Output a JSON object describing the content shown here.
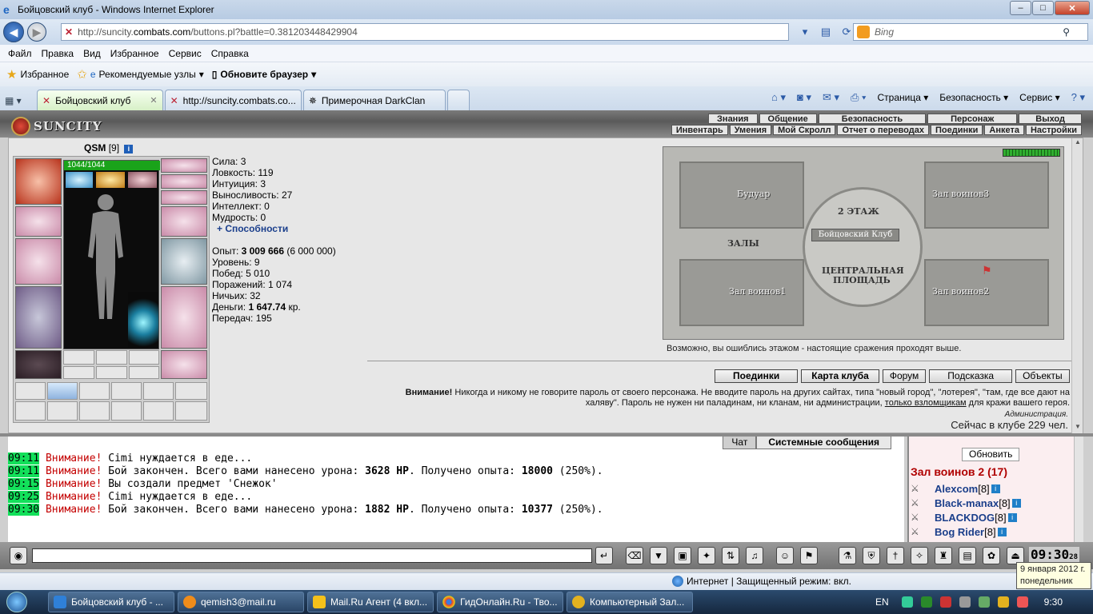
{
  "window": {
    "title": "Бойцовский клуб - Windows Internet Explorer"
  },
  "address": {
    "url_prefix": "http://suncity.",
    "url_domain": "combats.com",
    "url_rest": "/buttons.pl?battle=0.381203448429904",
    "search_placeholder": "Bing"
  },
  "menu": [
    "Файл",
    "Правка",
    "Вид",
    "Избранное",
    "Сервис",
    "Справка"
  ],
  "favbar": {
    "favorites": "Избранное",
    "suggested": "Рекомендуемые узлы",
    "update": "Обновите браузер"
  },
  "tabs": [
    {
      "label": "Бойцовский клуб"
    },
    {
      "label": "http://suncity.combats.co..."
    },
    {
      "label": "Примерочная DarkClan"
    }
  ],
  "cmdbar": {
    "page": "Страница",
    "safety": "Безопасность",
    "tools": "Сервис"
  },
  "game": {
    "logo": "SUNCITY",
    "top_menu": [
      "Знания",
      "Общение",
      "Безопасность",
      "Персонаж",
      "Выход"
    ],
    "sub_menu": [
      "Инвентарь",
      "Умения",
      "Мой Скролл",
      "Отчет о переводах",
      "Поединки",
      "Анкета",
      "Настройки"
    ],
    "character": {
      "name": "QSM",
      "level": "[9]",
      "info": "i",
      "hp": "1044/1044"
    },
    "stats": {
      "strength": "Сила: 3",
      "agility": "Ловкость: 119",
      "intuition": "Интуиция: 3",
      "endurance": "Выносливость: 27",
      "intellect": "Интеллект: 0",
      "wisdom": "Мудрость: 0",
      "abilities": "+ Способности",
      "exp_label": "Опыт: ",
      "exp_value": "3 009 666",
      "exp_next": " (6 000 000)",
      "level": "Уровень: 9",
      "wins": "Побед: 5 010",
      "losses": "Поражений: 1 074",
      "draws": "Ничьих: 32",
      "money_label": "Деньги: ",
      "money_value": "1 647.74",
      "money_unit": " кр.",
      "transfers": "Передач: 195"
    },
    "map": {
      "rooms": {
        "boudoir": "Будуар",
        "hall3": "Зал воинов3",
        "floor2": "2 ЭТАЖ",
        "club": "Бойцовский Клуб",
        "halls": "ЗАЛЫ",
        "central1": "ЦЕНТРАЛЬНАЯ",
        "central2": "ПЛОЩАДЬ",
        "hall1": "Зал воинов1",
        "hall2": "Зал воинов2"
      },
      "caption": "Возможно, вы ошиблись этажом - настоящие сражения проходят выше."
    },
    "nav_buttons": [
      "Поединки",
      "Карта клуба",
      "Форум",
      "Подсказка",
      "Объекты"
    ],
    "warning": {
      "head": "Внимание!",
      "text1": " Никогда и никому не говорите пароль от своего персонажа. Не вводите пароль на других сайтах, типа \"новый город\", \"лотерея\", \"там, где все дают на халяву\". Пароль не нужен ни паладинам, ни кланам, ни администрации, ",
      "link": "только взломщикам",
      "text2": " для кражи вашего героя.",
      "signature": "Администрация."
    },
    "online": "Сейчас в клубе 229 чел."
  },
  "chat": {
    "tabs": [
      "Чат",
      "Системные сообщения"
    ],
    "lines": [
      {
        "time": "09:11",
        "head": "Внимание!",
        "text": " Cimi нуждается в еде..."
      },
      {
        "time": "09:11",
        "head": "Внимание!",
        "text": " Бой закончен. Всего вами нанесено урона: ",
        "b1": "3628 HP",
        "text2": ". Получено опыта: ",
        "b2": "18000",
        "text3": " (250%)."
      },
      {
        "time": "09:15",
        "head": "Внимание!",
        "text": " Вы создали предмет 'Снежок'"
      },
      {
        "time": "09:25",
        "head": "Внимание!",
        "text": " Cimi нуждается в еде..."
      },
      {
        "time": "09:30",
        "head": "Внимание!",
        "text": " Бой закончен. Всего вами нанесено урона: ",
        "b1": "1882 HP",
        "text2": ". Получено опыта: ",
        "b2": "10377",
        "text3": " (250%)."
      }
    ]
  },
  "side": {
    "refresh": "Обновить",
    "room": "Зал воинов 2 (17)",
    "users": [
      {
        "name": "Alexcom",
        "level": "[8]"
      },
      {
        "name": "Black-manax",
        "level": "[8]"
      },
      {
        "name": "BLACKDOG",
        "level": "[8]"
      },
      {
        "name": "Bog Rider",
        "level": "[8]"
      }
    ]
  },
  "clock": {
    "time": "09:30",
    "sec": "28"
  },
  "status": {
    "zone": "Интернет | Защищенный режим: вкл."
  },
  "tooltip": {
    "line1": "9 января 2012 г.",
    "line2": "понедельник"
  },
  "taskbar": {
    "items": [
      "Бойцовский клуб - ...",
      "qemish3@mail.ru",
      "Mail.Ru Агент (4 вкл...",
      "ГидОнлайн.Ru - Тво...",
      "Компьютерный Зал..."
    ],
    "lang": "EN",
    "time": "9:30"
  }
}
